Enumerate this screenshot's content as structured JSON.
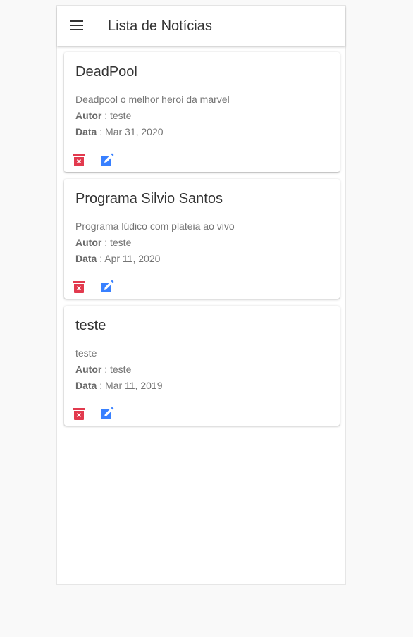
{
  "toolbar": {
    "title": "Lista de Notícias",
    "menu_icon": "menu-icon"
  },
  "colors": {
    "delete": "#e23a4e",
    "edit": "#3880ff",
    "title": "#333333",
    "body_text": "#757575"
  },
  "news": [
    {
      "title": "DeadPool",
      "description": "Deadpool o melhor heroi da marvel",
      "author_label": "Autor",
      "author": " : teste",
      "date_label": "Data",
      "date": " : Mar 31, 2020"
    },
    {
      "title": "Programa Silvio Santos",
      "description": "Programa lúdico com plateia ao vivo",
      "author_label": "Autor",
      "author": " : teste",
      "date_label": "Data",
      "date": " : Apr 11, 2020"
    },
    {
      "title": "teste",
      "description": "teste",
      "author_label": "Autor",
      "author": " : teste",
      "date_label": "Data",
      "date": " : Mar 11, 2019"
    }
  ],
  "icons": {
    "delete": "trash-icon",
    "edit": "edit-icon"
  }
}
